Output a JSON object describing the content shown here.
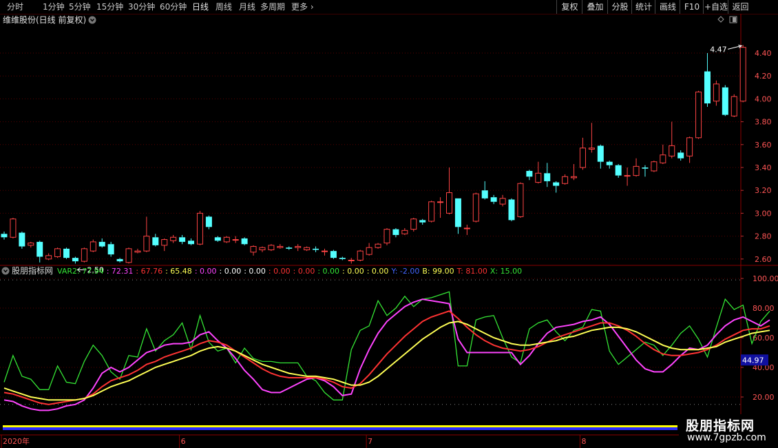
{
  "toolbar": {
    "periods": [
      "分时",
      "1分钟",
      "5分钟",
      "15分钟",
      "30分钟",
      "60分钟",
      "日线",
      "周线",
      "月线",
      "多周期",
      "更多"
    ],
    "active_period": "日线",
    "right_buttons": [
      "复权",
      "叠加",
      "分股",
      "统计",
      "画线",
      "F10",
      "+自选",
      "返回"
    ]
  },
  "main_panel": {
    "title": "维维股份(日线 前复权)",
    "y_ticks": [
      4.4,
      4.2,
      4.0,
      3.8,
      3.6,
      3.4,
      3.2,
      3.0,
      2.8,
      2.6
    ],
    "high_label": "4.47",
    "low_label": "2.50",
    "up_color": "#ff4444",
    "down_color": "#54ffff"
  },
  "indicator_panel": {
    "name": "股朋指标网",
    "readouts": [
      {
        "text": "VAR2: 77.94",
        "color": "#35e635"
      },
      {
        "text": ": 72.31",
        "color": "#ff44ff"
      },
      {
        "text": ": 67.76",
        "color": "#ff3333"
      },
      {
        "text": ": 65.48",
        "color": "#ffff55"
      },
      {
        "text": ": 0.00",
        "color": "#ff44ff"
      },
      {
        "text": ": 0.00",
        "color": "#ffffff"
      },
      {
        "text": ": 0.00",
        "color": "#ffffff"
      },
      {
        "text": ": 0.00",
        "color": "#ff3333"
      },
      {
        "text": ": 0.00",
        "color": "#ff3333"
      },
      {
        "text": ": 0.00",
        "color": "#35e635"
      },
      {
        "text": ": 0.00",
        "color": "#ffff55"
      },
      {
        "text": ": 0.00",
        "color": "#ffff55"
      },
      {
        "text": "Y: -2.00",
        "color": "#4466ff"
      },
      {
        "text": "B: 99.00",
        "color": "#ffff55"
      },
      {
        "text": "T: 81.00",
        "color": "#ff3333"
      },
      {
        "text": "X: 15.00",
        "color": "#35e635"
      }
    ],
    "y_ticks": [
      100.0,
      80.0,
      60.0,
      40.0,
      20.0
    ],
    "current_value": "44.97"
  },
  "x_axis": {
    "labels": [
      {
        "text": "2020年",
        "index": 0
      },
      {
        "text": "6",
        "index": 20
      },
      {
        "text": "7",
        "index": 41
      },
      {
        "text": "8",
        "index": 65
      }
    ]
  },
  "watermark": {
    "title": "股朋指标网",
    "url": "www.7gpzb.com"
  },
  "chart_data": {
    "type": "candlestick",
    "title": "维维股份(日线 前复权)",
    "ylim": [
      2.5,
      4.55
    ],
    "candles": [
      {
        "o": 2.82,
        "c": 2.79,
        "h": 2.84,
        "l": 2.77
      },
      {
        "o": 2.79,
        "c": 2.95,
        "h": 2.96,
        "l": 2.78
      },
      {
        "o": 2.83,
        "c": 2.71,
        "h": 2.84,
        "l": 2.69
      },
      {
        "o": 2.72,
        "c": 2.74,
        "h": 2.75,
        "l": 2.7
      },
      {
        "o": 2.75,
        "c": 2.62,
        "h": 2.76,
        "l": 2.57
      },
      {
        "o": 2.6,
        "c": 2.63,
        "h": 2.65,
        "l": 2.59
      },
      {
        "o": 2.62,
        "c": 2.69,
        "h": 2.7,
        "l": 2.61
      },
      {
        "o": 2.69,
        "c": 2.61,
        "h": 2.7,
        "l": 2.6
      },
      {
        "o": 2.61,
        "c": 2.58,
        "h": 2.62,
        "l": 2.56
      },
      {
        "o": 2.58,
        "c": 2.69,
        "h": 2.7,
        "l": 2.57
      },
      {
        "o": 2.67,
        "c": 2.75,
        "h": 2.77,
        "l": 2.66
      },
      {
        "o": 2.75,
        "c": 2.71,
        "h": 2.78,
        "l": 2.7
      },
      {
        "o": 2.73,
        "c": 2.64,
        "h": 2.75,
        "l": 2.62
      },
      {
        "o": 2.6,
        "c": 2.58,
        "h": 2.61,
        "l": 2.57
      },
      {
        "o": 2.57,
        "c": 2.69,
        "h": 2.7,
        "l": 2.56
      },
      {
        "o": 2.66,
        "c": 2.67,
        "h": 2.69,
        "l": 2.65
      },
      {
        "o": 2.67,
        "c": 2.8,
        "h": 2.97,
        "l": 2.66
      },
      {
        "o": 2.79,
        "c": 2.72,
        "h": 2.82,
        "l": 2.71
      },
      {
        "o": 2.72,
        "c": 2.77,
        "h": 2.78,
        "l": 2.67
      },
      {
        "o": 2.76,
        "c": 2.79,
        "h": 2.81,
        "l": 2.74
      },
      {
        "o": 2.79,
        "c": 2.75,
        "h": 2.81,
        "l": 2.73
      },
      {
        "o": 2.76,
        "c": 2.73,
        "h": 2.78,
        "l": 2.72
      },
      {
        "o": 2.73,
        "c": 3.0,
        "h": 3.02,
        "l": 2.72
      },
      {
        "o": 2.97,
        "c": 2.88,
        "h": 2.98,
        "l": 2.86
      },
      {
        "o": 2.79,
        "c": 2.76,
        "h": 2.8,
        "l": 2.75
      },
      {
        "o": 2.75,
        "c": 2.79,
        "h": 2.8,
        "l": 2.74
      },
      {
        "o": 2.77,
        "c": 2.77,
        "h": 2.8,
        "l": 2.74
      },
      {
        "o": 2.78,
        "c": 2.73,
        "h": 2.79,
        "l": 2.72
      },
      {
        "o": 2.66,
        "c": 2.71,
        "h": 2.72,
        "l": 2.63
      },
      {
        "o": 2.68,
        "c": 2.7,
        "h": 2.71,
        "l": 2.66
      },
      {
        "o": 2.68,
        "c": 2.72,
        "h": 2.73,
        "l": 2.67
      },
      {
        "o": 2.7,
        "c": 2.71,
        "h": 2.73,
        "l": 2.69
      },
      {
        "o": 2.7,
        "c": 2.69,
        "h": 2.71,
        "l": 2.68
      },
      {
        "o": 2.7,
        "c": 2.71,
        "h": 2.73,
        "l": 2.67
      },
      {
        "o": 2.68,
        "c": 2.7,
        "h": 2.71,
        "l": 2.67
      },
      {
        "o": 2.69,
        "c": 2.68,
        "h": 2.71,
        "l": 2.66
      },
      {
        "o": 2.67,
        "c": 2.67,
        "h": 2.69,
        "l": 2.63
      },
      {
        "o": 2.67,
        "c": 2.61,
        "h": 2.68,
        "l": 2.6
      },
      {
        "o": 2.61,
        "c": 2.6,
        "h": 2.62,
        "l": 2.59
      },
      {
        "o": 2.59,
        "c": 2.59,
        "h": 2.61,
        "l": 2.56
      },
      {
        "o": 2.59,
        "c": 2.67,
        "h": 2.68,
        "l": 2.58
      },
      {
        "o": 2.64,
        "c": 2.7,
        "h": 2.74,
        "l": 2.63
      },
      {
        "o": 2.7,
        "c": 2.73,
        "h": 2.74,
        "l": 2.69
      },
      {
        "o": 2.74,
        "c": 2.86,
        "h": 2.87,
        "l": 2.72
      },
      {
        "o": 2.86,
        "c": 2.81,
        "h": 2.87,
        "l": 2.79
      },
      {
        "o": 2.82,
        "c": 2.85,
        "h": 2.87,
        "l": 2.81
      },
      {
        "o": 2.86,
        "c": 2.95,
        "h": 2.96,
        "l": 2.84
      },
      {
        "o": 2.94,
        "c": 2.92,
        "h": 2.95,
        "l": 2.9
      },
      {
        "o": 2.93,
        "c": 3.1,
        "h": 3.11,
        "l": 2.92
      },
      {
        "o": 3.1,
        "c": 3.1,
        "h": 3.14,
        "l": 2.96
      },
      {
        "o": 3.0,
        "c": 3.18,
        "h": 3.4,
        "l": 2.99
      },
      {
        "o": 3.13,
        "c": 2.88,
        "h": 3.13,
        "l": 2.82
      },
      {
        "o": 2.87,
        "c": 2.87,
        "h": 2.9,
        "l": 2.81
      },
      {
        "o": 2.93,
        "c": 3.17,
        "h": 3.18,
        "l": 2.92
      },
      {
        "o": 3.2,
        "c": 3.13,
        "h": 3.28,
        "l": 3.12
      },
      {
        "o": 3.14,
        "c": 3.1,
        "h": 3.16,
        "l": 3.08
      },
      {
        "o": 3.08,
        "c": 3.13,
        "h": 3.16,
        "l": 3.06
      },
      {
        "o": 3.12,
        "c": 2.94,
        "h": 3.13,
        "l": 2.93
      },
      {
        "o": 2.97,
        "c": 3.26,
        "h": 3.27,
        "l": 2.96
      },
      {
        "o": 3.37,
        "c": 3.32,
        "h": 3.38,
        "l": 3.29
      },
      {
        "o": 3.27,
        "c": 3.35,
        "h": 3.45,
        "l": 3.26
      },
      {
        "o": 3.35,
        "c": 3.28,
        "h": 3.44,
        "l": 3.23
      },
      {
        "o": 3.27,
        "c": 3.24,
        "h": 3.28,
        "l": 3.18
      },
      {
        "o": 3.26,
        "c": 3.32,
        "h": 3.34,
        "l": 3.25
      },
      {
        "o": 3.31,
        "c": 3.32,
        "h": 3.43,
        "l": 3.29
      },
      {
        "o": 3.4,
        "c": 3.57,
        "h": 3.66,
        "l": 3.38
      },
      {
        "o": 3.56,
        "c": 3.57,
        "h": 3.79,
        "l": 3.53
      },
      {
        "o": 3.59,
        "c": 3.45,
        "h": 3.6,
        "l": 3.39
      },
      {
        "o": 3.45,
        "c": 3.42,
        "h": 3.46,
        "l": 3.39
      },
      {
        "o": 3.42,
        "c": 3.33,
        "h": 3.43,
        "l": 3.31
      },
      {
        "o": 3.33,
        "c": 3.33,
        "h": 3.4,
        "l": 3.24
      },
      {
        "o": 3.33,
        "c": 3.41,
        "h": 3.48,
        "l": 3.32
      },
      {
        "o": 3.4,
        "c": 3.39,
        "h": 3.42,
        "l": 3.32
      },
      {
        "o": 3.37,
        "c": 3.45,
        "h": 3.46,
        "l": 3.36
      },
      {
        "o": 3.44,
        "c": 3.51,
        "h": 3.6,
        "l": 3.43
      },
      {
        "o": 3.5,
        "c": 3.59,
        "h": 3.8,
        "l": 3.48
      },
      {
        "o": 3.53,
        "c": 3.48,
        "h": 3.55,
        "l": 3.46
      },
      {
        "o": 3.5,
        "c": 3.66,
        "h": 3.67,
        "l": 3.44
      },
      {
        "o": 3.66,
        "c": 4.06,
        "h": 4.07,
        "l": 3.65
      },
      {
        "o": 4.24,
        "c": 3.96,
        "h": 4.4,
        "l": 3.93
      },
      {
        "o": 3.98,
        "c": 4.13,
        "h": 4.16,
        "l": 3.94
      },
      {
        "o": 4.1,
        "c": 3.86,
        "h": 4.12,
        "l": 3.85
      },
      {
        "o": 3.85,
        "c": 4.02,
        "h": 4.04,
        "l": 3.84
      },
      {
        "o": 3.98,
        "c": 4.45,
        "h": 4.47,
        "l": 3.97
      }
    ],
    "indicator": {
      "ylim": [
        10,
        105
      ],
      "series": [
        {
          "name": "VAR2",
          "color": "#35e635",
          "values": [
            30,
            48,
            34,
            32,
            25,
            25,
            41,
            30,
            29,
            44,
            55,
            48,
            37,
            32,
            48,
            47,
            66,
            51,
            58,
            62,
            70,
            52,
            75,
            57,
            51,
            53,
            43,
            53,
            46,
            44,
            44,
            43,
            43,
            43,
            34,
            31,
            23,
            18,
            18,
            52,
            65,
            68,
            85,
            75,
            80,
            88,
            81,
            86,
            87,
            89,
            91,
            41,
            41,
            72,
            74,
            75,
            60,
            47,
            43,
            66,
            70,
            72,
            64,
            58,
            65,
            67,
            79,
            78,
            51,
            42,
            47,
            52,
            57,
            55,
            48,
            55,
            63,
            68,
            59,
            47,
            67,
            86,
            79,
            82,
            56,
            71,
            78
          ]
        },
        {
          "name": "",
          "color": "#ff44ff",
          "values": [
            18,
            17,
            14,
            12,
            11,
            11,
            12,
            14,
            15,
            18,
            26,
            36,
            40,
            37,
            40,
            45,
            50,
            52,
            55,
            56,
            56,
            57,
            62,
            64,
            58,
            53,
            46,
            38,
            32,
            25,
            23,
            23,
            26,
            29,
            32,
            33,
            31,
            27,
            21,
            22,
            39,
            52,
            63,
            71,
            76,
            81,
            84,
            86,
            85,
            84,
            83,
            59,
            50,
            50,
            50,
            50,
            50,
            50,
            42,
            48,
            56,
            63,
            67,
            68,
            69,
            71,
            72,
            74,
            69,
            61,
            53,
            45,
            39,
            37,
            37,
            42,
            48,
            53,
            52,
            55,
            62,
            68,
            72,
            74,
            71,
            68,
            72
          ]
        },
        {
          "name": "",
          "color": "#ff3333",
          "values": [
            23,
            22,
            20,
            18,
            16,
            15,
            16,
            17,
            18,
            19,
            22,
            27,
            31,
            33,
            35,
            38,
            42,
            44,
            47,
            49,
            51,
            53,
            56,
            58,
            57,
            55,
            51,
            47,
            43,
            39,
            36,
            34,
            33,
            33,
            33,
            33,
            32,
            30,
            27,
            26,
            29,
            35,
            42,
            49,
            55,
            61,
            66,
            71,
            74,
            76,
            78,
            73,
            67,
            62,
            58,
            55,
            53,
            52,
            51,
            52,
            54,
            57,
            60,
            62,
            64,
            66,
            68,
            70,
            70,
            68,
            65,
            61,
            56,
            52,
            49,
            48,
            48,
            49,
            50,
            52,
            55,
            59,
            62,
            65,
            66,
            66,
            68
          ]
        },
        {
          "name": "",
          "color": "#ffff55",
          "values": [
            26,
            24,
            22,
            20,
            19,
            18,
            18,
            18,
            18,
            19,
            21,
            24,
            27,
            29,
            31,
            34,
            37,
            40,
            42,
            44,
            46,
            48,
            51,
            53,
            54,
            53,
            51,
            48,
            45,
            42,
            40,
            38,
            36,
            35,
            34,
            34,
            33,
            32,
            30,
            28,
            28,
            30,
            34,
            39,
            44,
            49,
            54,
            59,
            63,
            67,
            70,
            71,
            69,
            66,
            63,
            60,
            58,
            56,
            55,
            55,
            56,
            57,
            58,
            60,
            61,
            63,
            65,
            66,
            67,
            67,
            66,
            64,
            61,
            58,
            55,
            53,
            52,
            52,
            52,
            53,
            54,
            57,
            59,
            61,
            63,
            64,
            65
          ]
        }
      ]
    }
  }
}
